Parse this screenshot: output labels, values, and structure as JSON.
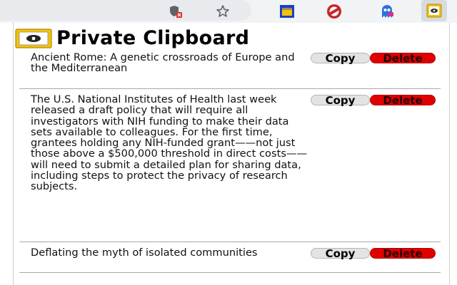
{
  "toolbar": {
    "icons": [
      "shield-blocked-icon",
      "star-icon",
      "screenshot-extension-icon",
      "blocker-extension-icon",
      "ghost-extension-icon",
      "clipboard-extension-icon"
    ]
  },
  "popup": {
    "title": "Private Clipboard",
    "icon": "clipboard-logo-icon"
  },
  "entries": [
    {
      "text": "Ancient Rome: A genetic crossroads of Europe and the Mediterranean",
      "copy_label": "Copy",
      "delete_label": "Delete"
    },
    {
      "text": "The U.S. National Institutes of Health last week released a draft policy that will require all investigators with NIH funding to make their data sets available to colleagues. For the first time, grantees holding any NIH-funded grant——not just those above a $500,000 threshold in direct costs——will need to submit a detailed plan for sharing data, including steps to protect the privacy of research subjects.",
      "copy_label": "Copy",
      "delete_label": "Delete"
    },
    {
      "text": "Deflating the myth of isolated communities",
      "copy_label": "Copy",
      "delete_label": "Delete"
    }
  ],
  "colors": {
    "delete": "#e00000",
    "copy": "#e3e3e3",
    "toolbar": "#f1f3f4"
  }
}
